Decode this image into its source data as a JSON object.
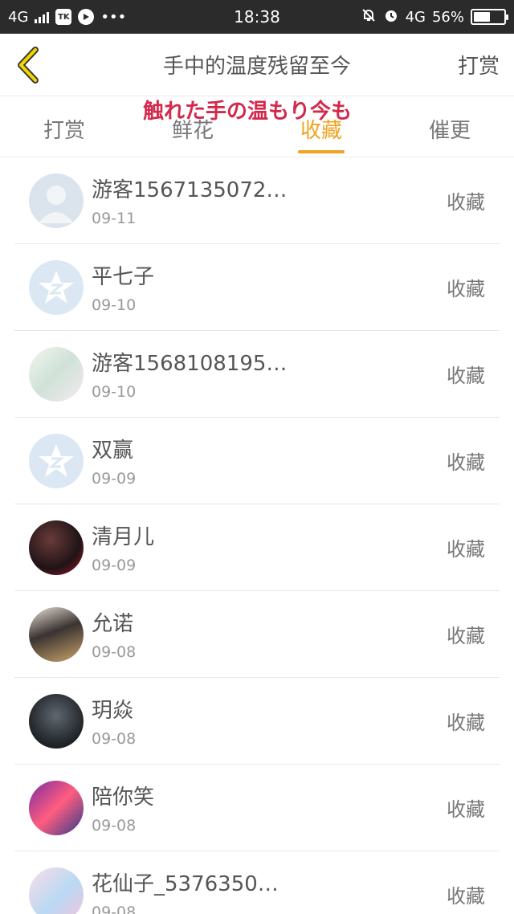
{
  "status_bar": {
    "network_left": "4G",
    "time": "18:38",
    "network_right": "4G",
    "battery": "56%",
    "battery_level": 0.56
  },
  "header": {
    "title": "手中的温度残留至今",
    "action_label": "打赏"
  },
  "overlay_lyric": "触れた手の温もり今も",
  "tabs": [
    {
      "label": "打赏",
      "active": false
    },
    {
      "label": "鲜花",
      "active": false
    },
    {
      "label": "收藏",
      "active": true
    },
    {
      "label": "催更",
      "active": false
    }
  ],
  "accent_color": "#f0a31f",
  "rows": [
    {
      "name": "游客1567135072…",
      "date": "09-11",
      "action": "收藏",
      "avatar": "default-avatar"
    },
    {
      "name": "平七子",
      "date": "09-10",
      "action": "收藏",
      "avatar": "qq-star-avatar"
    },
    {
      "name": "游客1568108195…",
      "date": "09-10",
      "action": "收藏",
      "avatar": "anime-avatar"
    },
    {
      "name": "双赢",
      "date": "09-09",
      "action": "收藏",
      "avatar": "qq-star-avatar"
    },
    {
      "name": "清月儿",
      "date": "09-09",
      "action": "收藏",
      "avatar": "photo-avatar"
    },
    {
      "name": "允诺",
      "date": "09-08",
      "action": "收藏",
      "avatar": "photo-avatar"
    },
    {
      "name": "玥焱",
      "date": "09-08",
      "action": "收藏",
      "avatar": "photo-avatar"
    },
    {
      "name": "陪你笑",
      "date": "09-08",
      "action": "收藏",
      "avatar": "photo-avatar"
    },
    {
      "name": "花仙子_5376350…",
      "date": "09-08",
      "action": "收藏",
      "avatar": "anime-avatar"
    }
  ]
}
